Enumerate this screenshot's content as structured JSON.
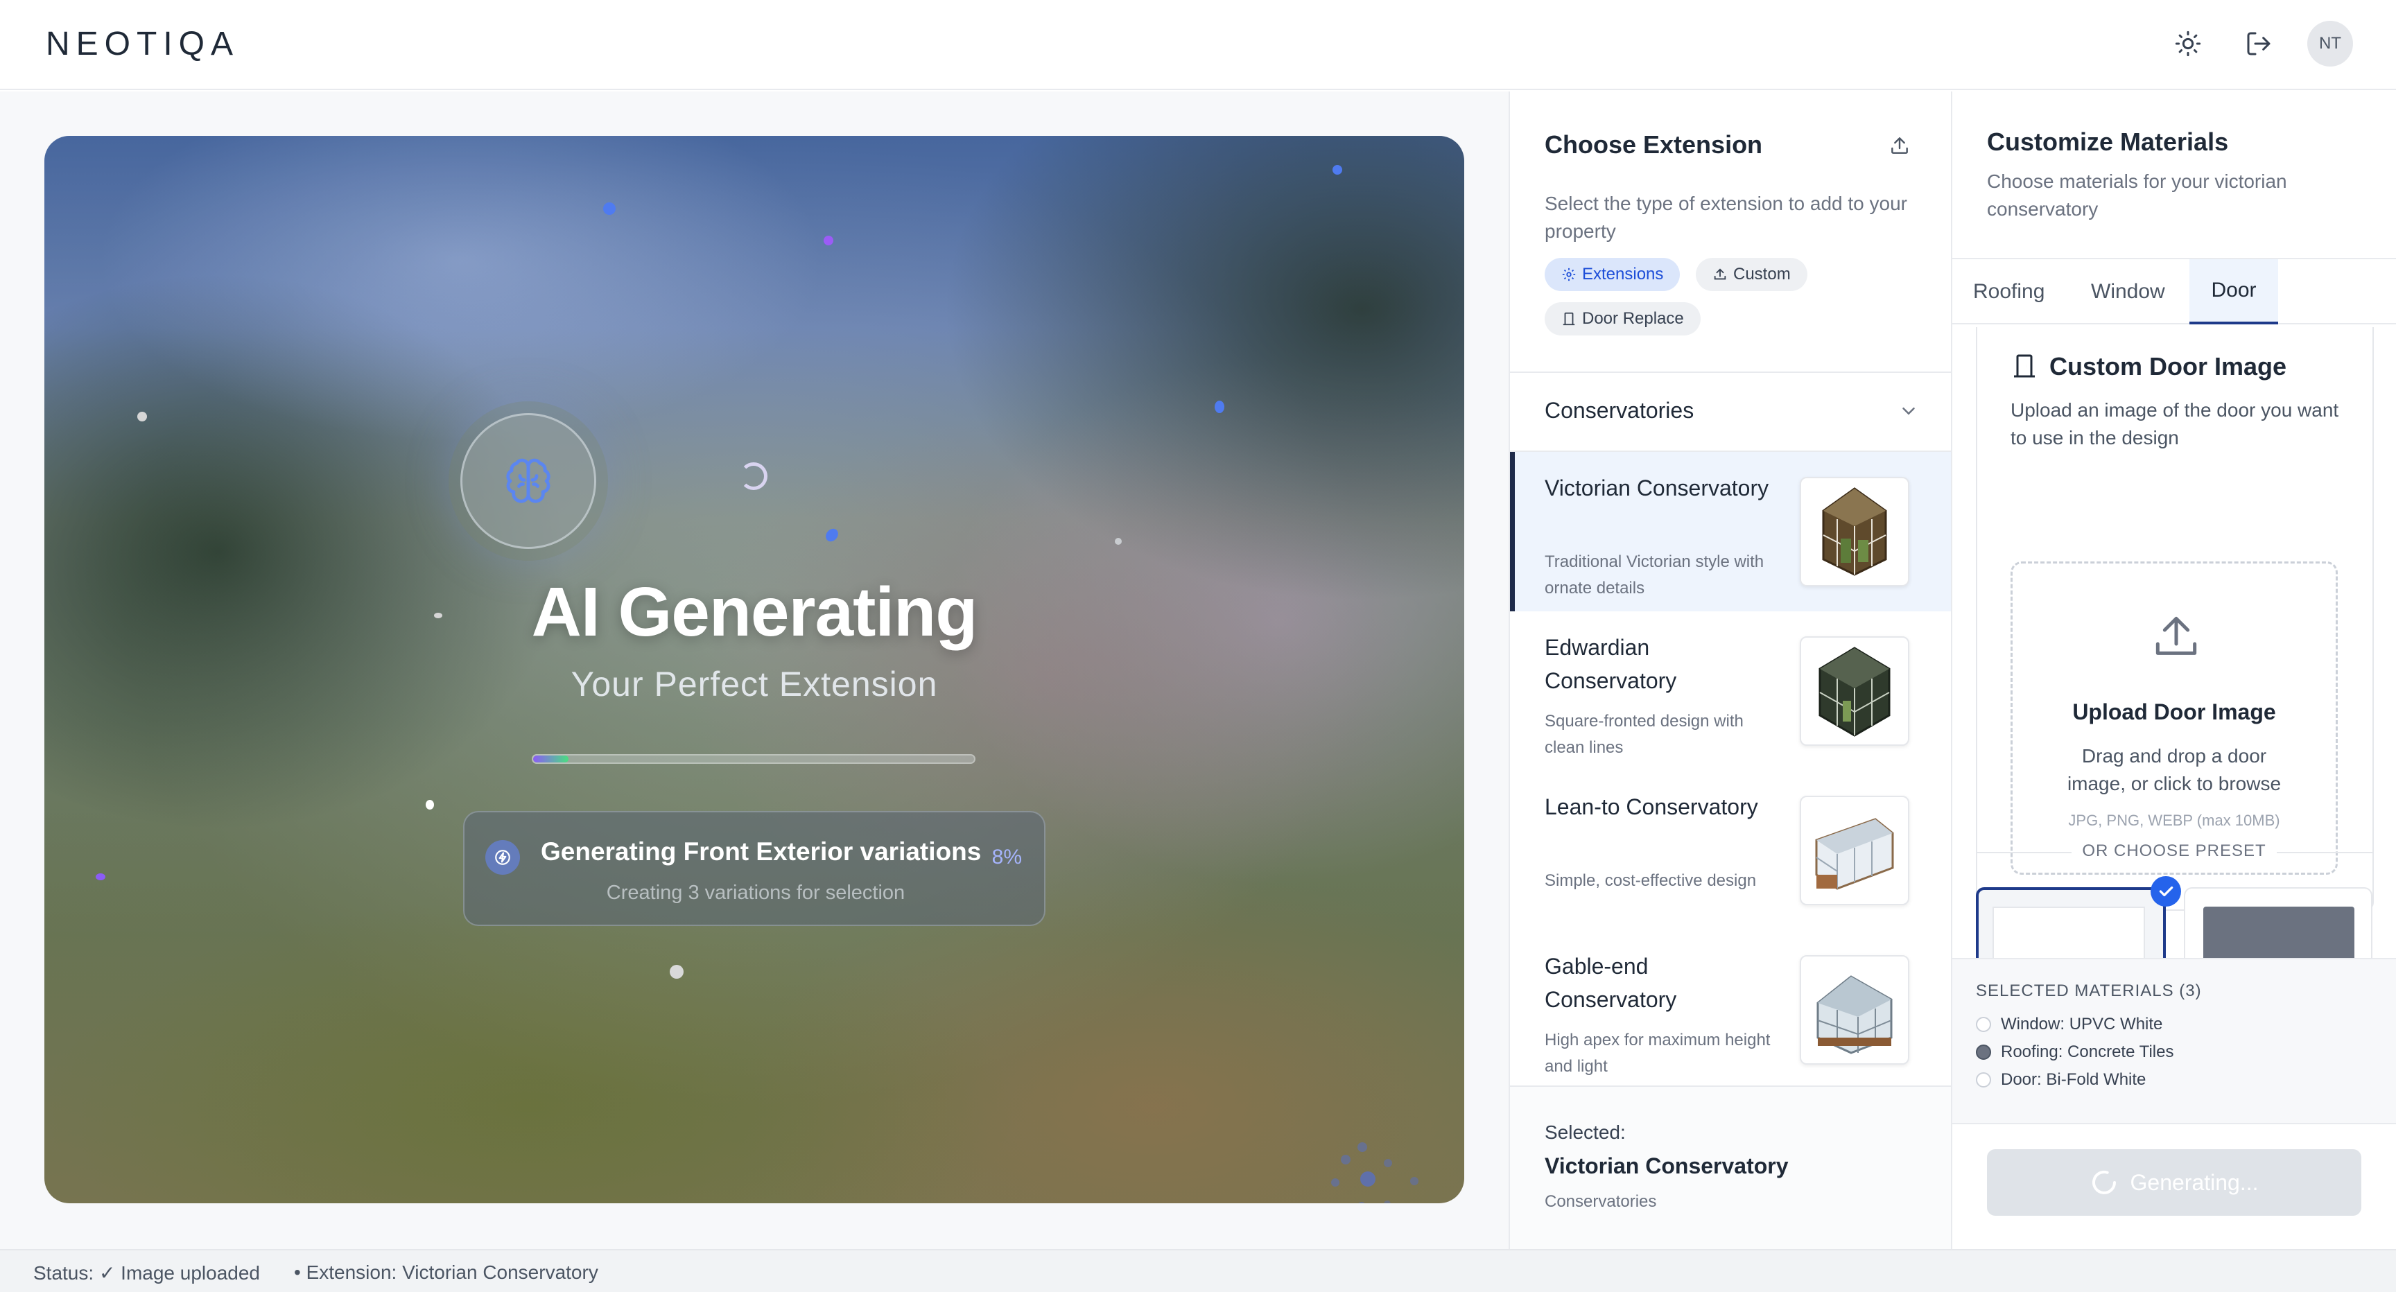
{
  "header": {
    "logo": "NEOTIQA",
    "theme_icon": "sun-icon",
    "logout_icon": "logout-icon",
    "avatar_initials": "NT"
  },
  "preview": {
    "title": "AI Generating",
    "subtitle": "Your Perfect Extension",
    "progress_fraction": 0.08,
    "status_title": "Generating Front Exterior variations",
    "status_percent": "8%",
    "status_sub": "Creating 3 variations for selection"
  },
  "extension_panel": {
    "title": "Choose Extension",
    "description": "Select the type of extension to add to your property",
    "chips": [
      {
        "label": "Extensions",
        "icon": "gear-icon",
        "active": true
      },
      {
        "label": "Custom",
        "icon": "upload-icon",
        "active": false
      },
      {
        "label": "Door Replace",
        "icon": "door-icon",
        "active": false
      }
    ],
    "section_title": "Conservatories",
    "items": [
      {
        "title": "Victorian Conservatory",
        "desc": "Traditional Victorian style with ornate details",
        "selected": true
      },
      {
        "title": "Edwardian Conservatory",
        "desc": "Square-fronted design with clean lines",
        "selected": false
      },
      {
        "title": "Lean-to Conservatory",
        "desc": "Simple, cost-effective design",
        "selected": false
      },
      {
        "title": "Gable-end Conservatory",
        "desc": "High apex for maximum height and light",
        "selected": false
      }
    ],
    "selected_label": "Selected:",
    "selected_name": "Victorian Conservatory",
    "selected_category": "Conservatories"
  },
  "materials_panel": {
    "title": "Customize Materials",
    "description": "Choose materials for your victorian conservatory",
    "tabs": [
      "Roofing",
      "Window",
      "Door"
    ],
    "active_tab": "Door",
    "door_card_title": "Custom Door Image",
    "door_card_desc": "Upload an image of the door you want to use in the design",
    "upload_title": "Upload Door Image",
    "upload_desc": "Drag and drop a door image, or click to browse",
    "upload_formats": "JPG, PNG, WEBP (max 10MB)",
    "preset_divider": "OR CHOOSE PRESET",
    "selected_materials_title": "SELECTED MATERIALS (3)",
    "selected_materials": [
      {
        "label": "Window: UPVC White",
        "filled": false
      },
      {
        "label": "Roofing: Concrete Tiles",
        "filled": true
      },
      {
        "label": "Door: Bi-Fold White",
        "filled": false
      }
    ],
    "generate_button": "Generating..."
  },
  "statusbar": {
    "status": "Status: ✓ Image uploaded",
    "extension": "• Extension: Victorian Conservatory"
  },
  "colors": {
    "accent": "#1d4ed8",
    "selected_bg": "#eef4fd",
    "progress_start": "#8b5cf6",
    "progress_end": "#4ade80"
  }
}
